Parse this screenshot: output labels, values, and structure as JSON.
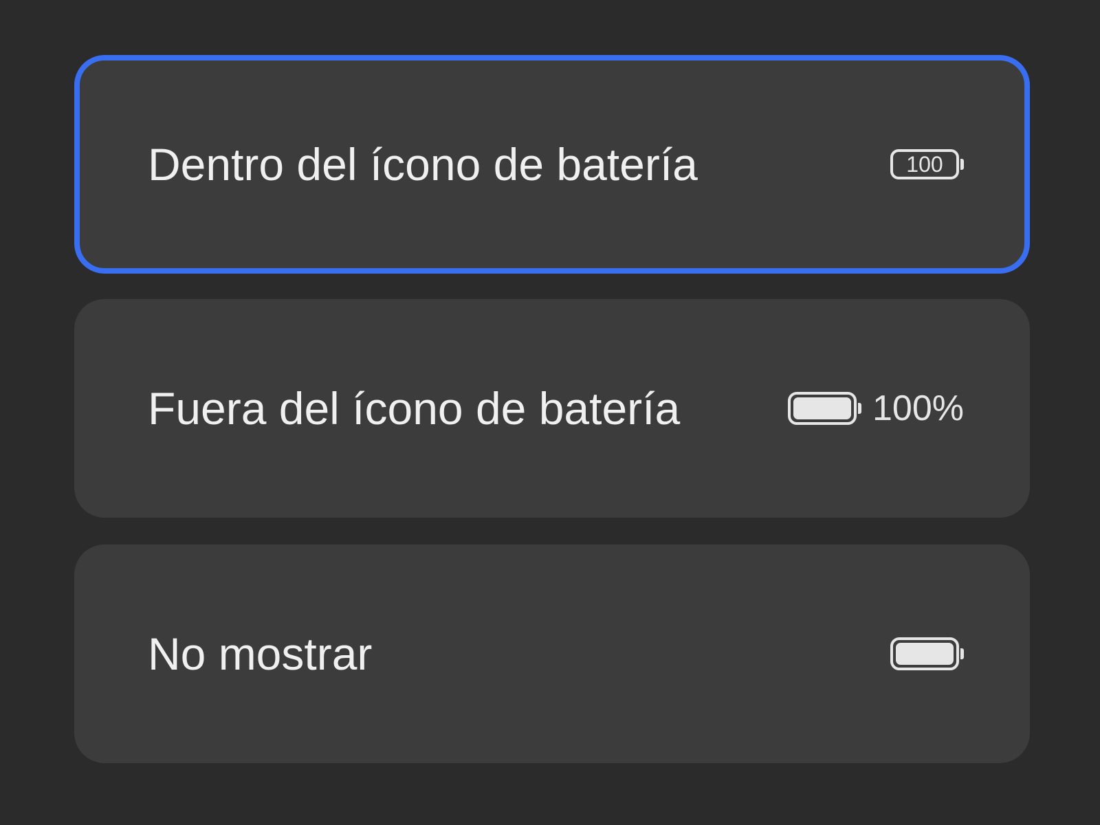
{
  "accent_color": "#3a6ef0",
  "selected_index": 0,
  "options": [
    {
      "label": "Dentro del ícono de batería",
      "preview": {
        "type": "battery-with-number-inside",
        "icon": "battery-icon",
        "value_text": "100"
      }
    },
    {
      "label": "Fuera del ícono de batería",
      "preview": {
        "type": "battery-with-percent-outside",
        "icon": "battery-full-icon",
        "value_text": "100%"
      }
    },
    {
      "label": "No mostrar",
      "preview": {
        "type": "battery-only",
        "icon": "battery-full-icon"
      }
    }
  ]
}
